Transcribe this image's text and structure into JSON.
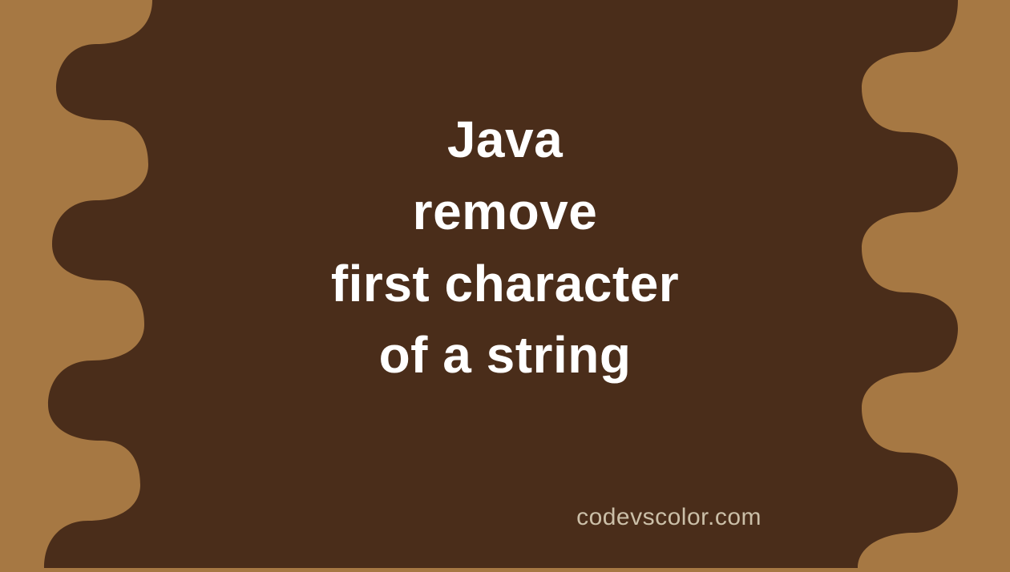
{
  "title": {
    "line1": "Java",
    "line2": "remove",
    "line3": "first character",
    "line4": "of a string"
  },
  "site": "codevscolor.com",
  "colors": {
    "background": "#a67843",
    "blob": "#4a2d1a",
    "text": "#ffffff",
    "site": "#cbbfa8"
  }
}
